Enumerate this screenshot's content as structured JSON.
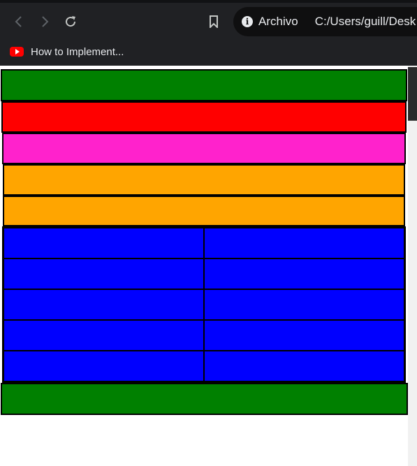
{
  "browser": {
    "site_chip_label": "Archivo",
    "url": "C:/Users/guill/Desk",
    "bookmark_label": "How to Implement..."
  },
  "colors": {
    "green": "#008000",
    "red": "#ff0000",
    "pink": "#ff22cc",
    "orange": "#ffa500",
    "blue": "#0000ff"
  },
  "page": {
    "rows": [
      {
        "name": "green-bar-top",
        "color": "green"
      },
      {
        "name": "red-bar",
        "color": "red"
      },
      {
        "name": "pink-bar",
        "color": "pink"
      },
      {
        "name": "orange-bar-1",
        "color": "orange"
      },
      {
        "name": "orange-bar-2",
        "color": "orange"
      }
    ],
    "grid": {
      "rows": 5,
      "cols": 2,
      "color": "blue"
    },
    "footer": {
      "name": "green-bar-bottom",
      "color": "green"
    }
  }
}
